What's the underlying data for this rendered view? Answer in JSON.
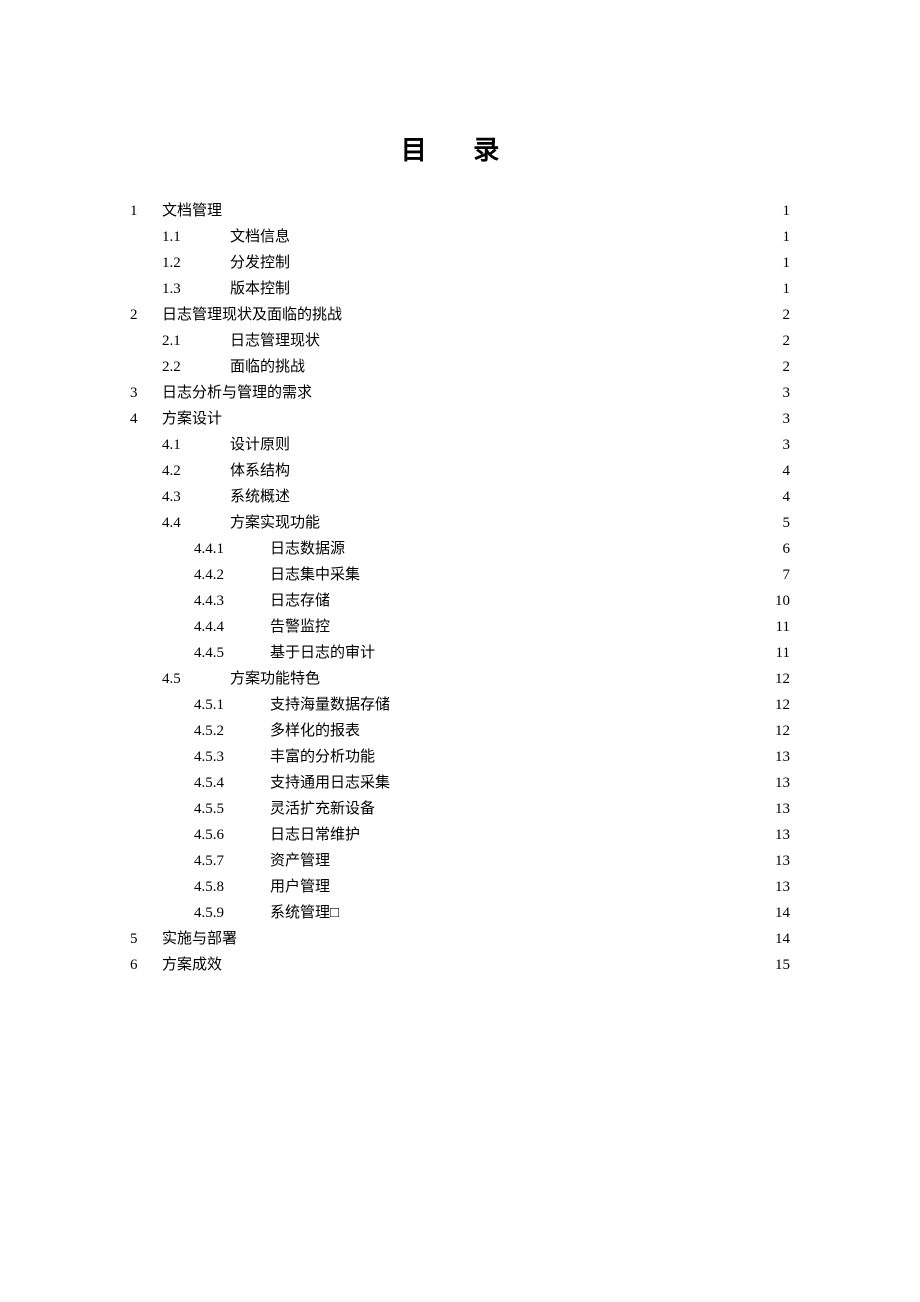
{
  "title": "目 录",
  "entries": [
    {
      "level": 0,
      "num": "1",
      "text": "文档管理",
      "page": "1"
    },
    {
      "level": 1,
      "num": "1.1",
      "text": "文档信息",
      "page": "1"
    },
    {
      "level": 1,
      "num": "1.2",
      "text": "分发控制",
      "page": "1"
    },
    {
      "level": 1,
      "num": "1.3",
      "text": "版本控制",
      "page": "1"
    },
    {
      "level": 0,
      "num": "2",
      "text": "日志管理现状及面临的挑战",
      "page": "2"
    },
    {
      "level": 1,
      "num": "2.1",
      "text": "日志管理现状",
      "page": "2"
    },
    {
      "level": 1,
      "num": "2.2",
      "text": "面临的挑战",
      "page": "2"
    },
    {
      "level": 0,
      "num": "3",
      "text": "日志分析与管理的需求",
      "page": "3"
    },
    {
      "level": 0,
      "num": "4",
      "text": "方案设计",
      "page": "3"
    },
    {
      "level": 1,
      "num": "4.1",
      "text": "设计原则",
      "page": "3"
    },
    {
      "level": 1,
      "num": "4.2",
      "text": "体系结构",
      "page": "4"
    },
    {
      "level": 1,
      "num": "4.3",
      "text": "系统概述",
      "page": "4"
    },
    {
      "level": 1,
      "num": "4.4",
      "text": "方案实现功能",
      "page": "5"
    },
    {
      "level": 2,
      "num": "4.4.1",
      "text": "日志数据源",
      "page": "6"
    },
    {
      "level": 2,
      "num": "4.4.2",
      "text": "日志集中采集",
      "page": "7"
    },
    {
      "level": 2,
      "num": "4.4.3",
      "text": "日志存储",
      "page": "10"
    },
    {
      "level": 2,
      "num": "4.4.4",
      "text": "告警监控",
      "page": "11"
    },
    {
      "level": 2,
      "num": "4.4.5",
      "text": "基于日志的审计",
      "page": "11"
    },
    {
      "level": 1,
      "num": "4.5",
      "text": "方案功能特色",
      "page": "12"
    },
    {
      "level": 2,
      "num": "4.5.1",
      "text": "支持海量数据存储",
      "page": "12"
    },
    {
      "level": 2,
      "num": "4.5.2",
      "text": "多样化的报表",
      "page": "12"
    },
    {
      "level": 2,
      "num": "4.5.3",
      "text": "丰富的分析功能",
      "page": "13"
    },
    {
      "level": 2,
      "num": "4.5.4",
      "text": "支持通用日志采集",
      "page": "13"
    },
    {
      "level": 2,
      "num": "4.5.5",
      "text": "灵活扩充新设备",
      "page": "13"
    },
    {
      "level": 2,
      "num": "4.5.6",
      "text": "日志日常维护",
      "page": "13"
    },
    {
      "level": 2,
      "num": "4.5.7",
      "text": "资产管理",
      "page": "13"
    },
    {
      "level": 2,
      "num": "4.5.8",
      "text": "用户管理",
      "page": "13"
    },
    {
      "level": 2,
      "num": "4.5.9",
      "text": "系统管理□",
      "page": "14"
    },
    {
      "level": 0,
      "num": "5",
      "text": "实施与部署",
      "page": "14"
    },
    {
      "level": 0,
      "num": "6",
      "text": "方案成效",
      "page": "15"
    }
  ]
}
